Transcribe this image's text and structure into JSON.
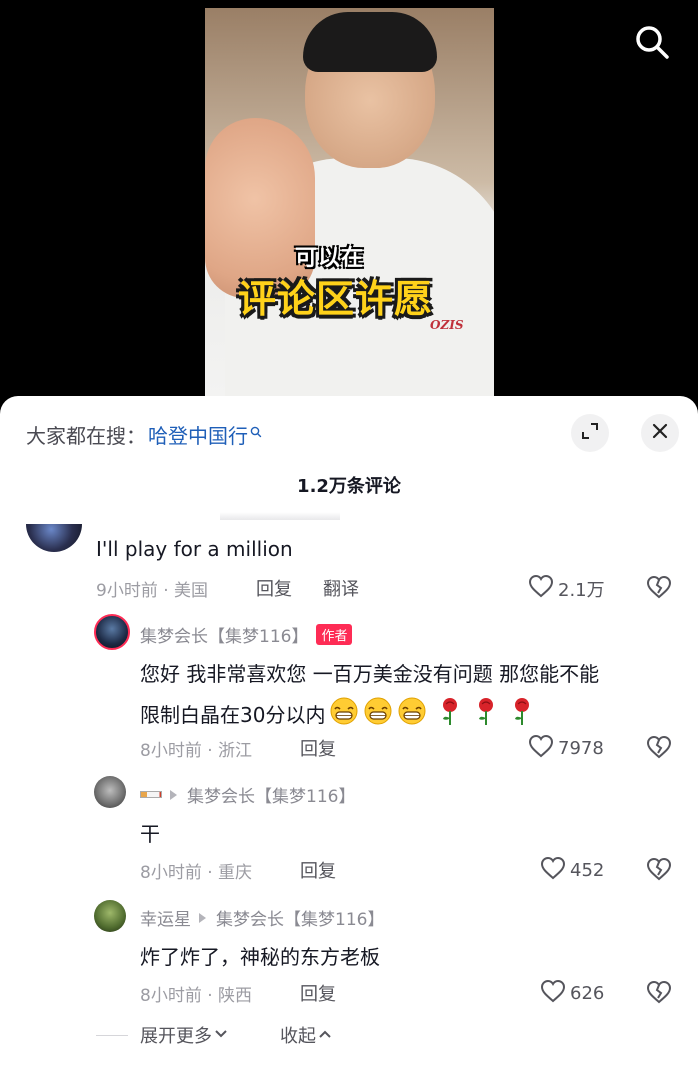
{
  "video": {
    "caption_line1": "可以在",
    "caption_line2": "评论区许愿",
    "brand_mark": "OZIS"
  },
  "sheet": {
    "hot_search_label": "大家都在搜：",
    "hot_search_keyword": "哈登中国行",
    "comment_count": "1.2万条评论"
  },
  "comments": {
    "main": {
      "text": "I'll play for a million",
      "meta": "9小时前 · 美国",
      "reply": "回复",
      "translate": "翻译",
      "likes": "2.1万"
    },
    "replies": [
      {
        "username": "集梦会长【集梦116】",
        "badge": "作者",
        "text_line1": "您好 我非常喜欢您 一百万美金没有问题 那您能不能",
        "text_line2": "限制白晶在30分以内",
        "meta": "8小时前 · 浙江",
        "reply": "回复",
        "likes": "7978"
      },
      {
        "reply_to": "集梦会长【集梦116】",
        "text": "干",
        "meta": "8小时前 · 重庆",
        "reply": "回复",
        "likes": "452"
      },
      {
        "username": "幸运星",
        "reply_to": "集梦会长【集梦116】",
        "text": "炸了炸了，神秘的东方老板",
        "meta": "8小时前 · 陕西",
        "reply": "回复",
        "likes": "626"
      }
    ]
  },
  "footer": {
    "expand_more": "展开更多",
    "collapse": "收起"
  },
  "colors": {
    "accent_red": "#fe2c55",
    "keyword_blue": "#1f5fb8",
    "caption_yellow": "#ffd21a"
  },
  "icons": [
    "search-icon",
    "expand-icon",
    "close-icon",
    "heart-icon",
    "broken-heart-icon",
    "grin-emoji",
    "rose-emoji",
    "cigarette-emoji",
    "chevron-down-icon",
    "chevron-up-icon"
  ]
}
